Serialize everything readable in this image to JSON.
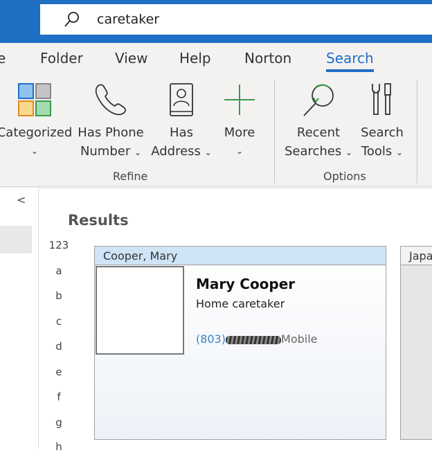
{
  "search": {
    "query": "caretaker",
    "icon": "search-icon"
  },
  "tabs": [
    {
      "label": "e"
    },
    {
      "label": "Folder"
    },
    {
      "label": "View"
    },
    {
      "label": "Help"
    },
    {
      "label": "Norton"
    },
    {
      "label": "Search",
      "active": true
    }
  ],
  "ribbon": {
    "refine": {
      "label": "Refine",
      "buttons": [
        {
          "line1": "Categorized",
          "line2": ""
        },
        {
          "line1": "Has Phone",
          "line2": "Number"
        },
        {
          "line1": "Has",
          "line2": "Address"
        },
        {
          "line1": "More",
          "line2": ""
        }
      ]
    },
    "options": {
      "label": "Options",
      "buttons": [
        {
          "line1": "Recent",
          "line2": "Searches"
        },
        {
          "line1": "Search",
          "line2": "Tools"
        }
      ]
    }
  },
  "results": {
    "heading": "Results",
    "index": [
      "123",
      "a",
      "b",
      "c",
      "d",
      "e",
      "f",
      "g",
      "h"
    ]
  },
  "cards": [
    {
      "header": "Cooper, Mary",
      "name": "Mary Cooper",
      "job": "Home caretaker",
      "phone_prefix": "(803)",
      "phone_label": "Mobile"
    },
    {
      "header": "Japa"
    }
  ],
  "colors": {
    "accent": "#1f6fc4",
    "card_header": "#cfe4f7",
    "phone": "#3a86c8"
  }
}
